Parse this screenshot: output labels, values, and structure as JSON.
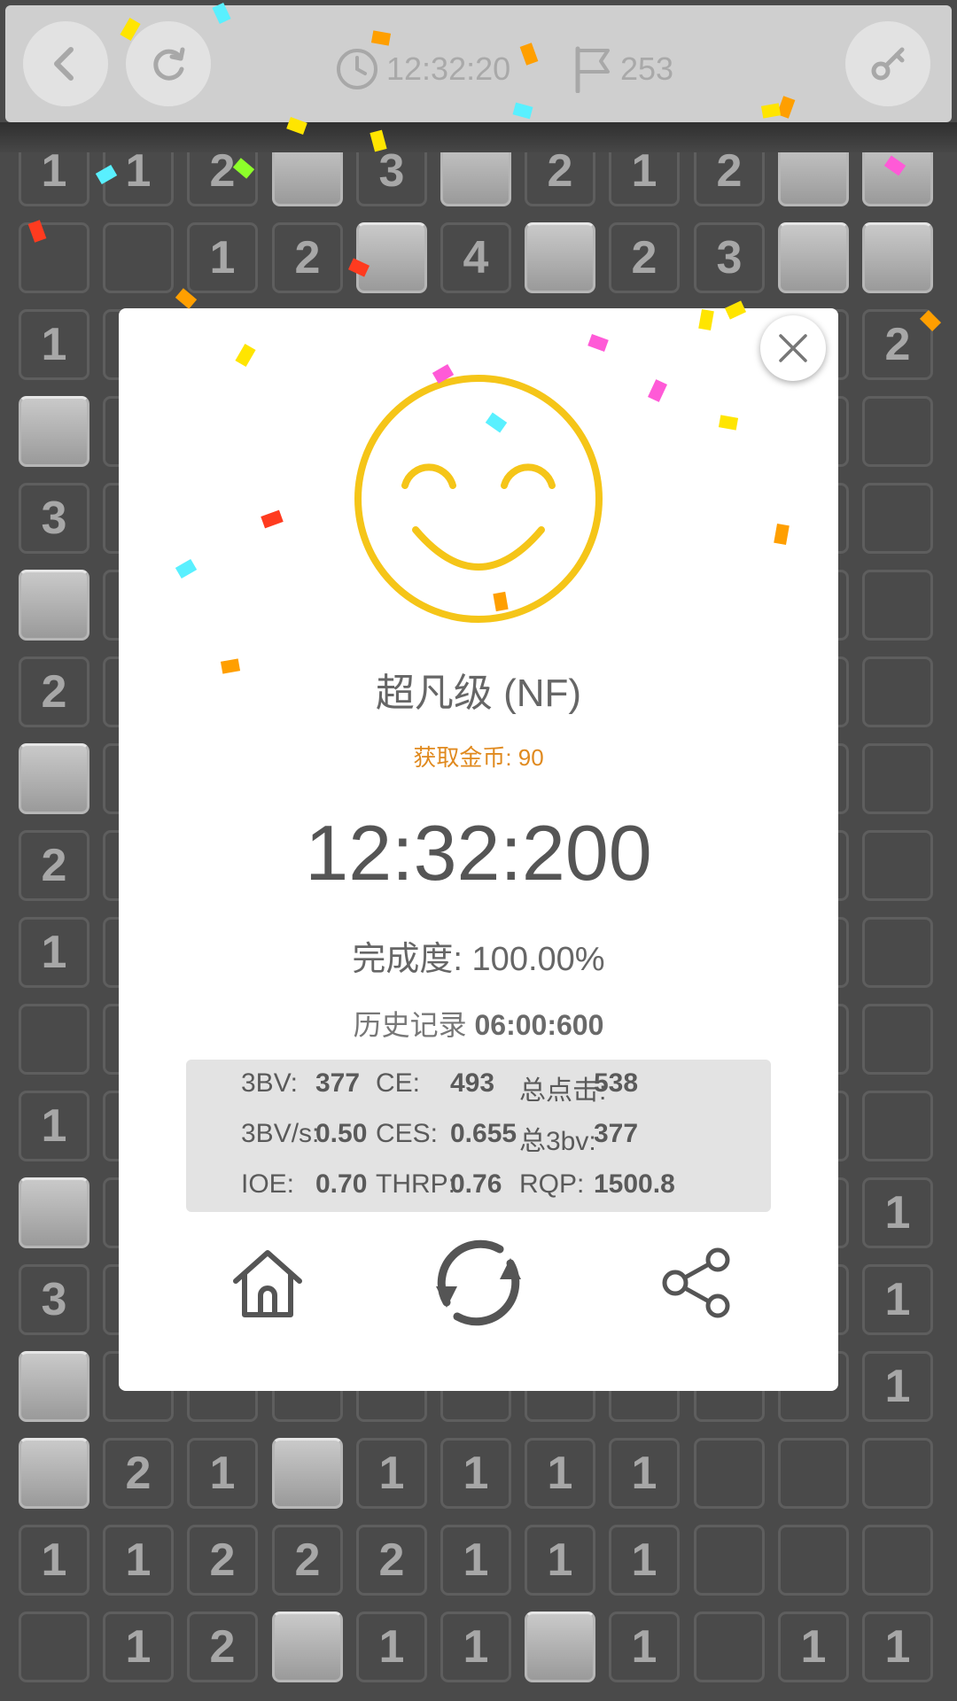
{
  "topbar": {
    "time": "12:32:20",
    "flags": "253",
    "back_icon": "chevron-left-icon",
    "restart_icon": "refresh-icon",
    "clock_icon": "clock-icon",
    "flag_icon": "flag-icon",
    "settings_icon": "key-icon"
  },
  "board_rows": [
    [
      "1",
      "1",
      "2",
      "#",
      "3",
      "#",
      "2",
      "1",
      "2",
      "#",
      "#"
    ],
    [
      "",
      "",
      "1",
      "2",
      "#",
      "4",
      "#",
      "2",
      "3",
      "#",
      "#"
    ],
    [
      "1",
      "",
      "",
      "",
      "",
      "",
      "",
      "",
      "",
      "",
      "2"
    ],
    [
      "#",
      "",
      "",
      "",
      "",
      "",
      "",
      "",
      "",
      "",
      ""
    ],
    [
      "3",
      "",
      "",
      "",
      "",
      "",
      "",
      "",
      "",
      "",
      ""
    ],
    [
      "#",
      "",
      "",
      "",
      "",
      "",
      "",
      "",
      "",
      "",
      ""
    ],
    [
      "2",
      "",
      "",
      "",
      "",
      "",
      "",
      "",
      "",
      "",
      ""
    ],
    [
      "#",
      "",
      "",
      "",
      "",
      "",
      "",
      "",
      "",
      "",
      ""
    ],
    [
      "2",
      "",
      "",
      "",
      "",
      "",
      "",
      "",
      "",
      "",
      ""
    ],
    [
      "1",
      "",
      "",
      "",
      "",
      "",
      "",
      "",
      "",
      "",
      ""
    ],
    [
      "",
      "",
      "",
      "",
      "",
      "",
      "",
      "",
      "",
      "",
      ""
    ],
    [
      "1",
      "",
      "",
      "",
      "",
      "",
      "",
      "",
      "",
      "",
      ""
    ],
    [
      "#",
      "",
      "",
      "",
      "",
      "",
      "",
      "",
      "",
      "",
      "1"
    ],
    [
      "3",
      "",
      "",
      "",
      "",
      "",
      "",
      "",
      "",
      "",
      "1"
    ],
    [
      "#",
      "",
      "",
      "",
      "",
      "",
      "",
      "",
      "",
      "",
      "1"
    ],
    [
      "#",
      "2",
      "1",
      "#",
      "1",
      "1",
      "1",
      "1",
      "",
      "",
      ""
    ],
    [
      "1",
      "1",
      "2",
      "2",
      "2",
      "1",
      "1",
      "1",
      "",
      "",
      ""
    ],
    [
      "",
      "1",
      "2",
      "#",
      "1",
      "1",
      "#",
      "1",
      "",
      "1",
      "1"
    ]
  ],
  "result": {
    "rank": "超凡级 (NF)",
    "coins_label": "获取金币: 90",
    "time": "12:32:200",
    "completion_label": "完成度: ",
    "completion_value": "100.00%",
    "history_label": "历史记录 ",
    "history_value": "06:00:600",
    "smiley_icon": "smiley-face-icon"
  },
  "stats": [
    {
      "label": "3BV:",
      "value": "377"
    },
    {
      "label": "CE:",
      "value": "493"
    },
    {
      "label": "总点击:",
      "value": "538"
    },
    {
      "label": "3BV/s:",
      "value": "0.50"
    },
    {
      "label": "CES:",
      "value": "0.655"
    },
    {
      "label": "总3bv:",
      "value": "377"
    },
    {
      "label": "IOE:",
      "value": "0.70"
    },
    {
      "label": "THRP:",
      "value": "0.76"
    },
    {
      "label": "RQP:",
      "value": "1500.8"
    }
  ],
  "actions": {
    "home_icon": "home-icon",
    "replay_icon": "replay-icon",
    "share_icon": "share-icon",
    "close_icon": "close-icon"
  },
  "colors": {
    "accent_yellow": "#f5c518",
    "coin_orange": "#e08a1f",
    "board_bg": "#4a4a4a",
    "confetti": [
      "#ffe500",
      "#ff9f00",
      "#59f0ff",
      "#ff5ad7",
      "#ff3b1f",
      "#8dff2a"
    ]
  }
}
